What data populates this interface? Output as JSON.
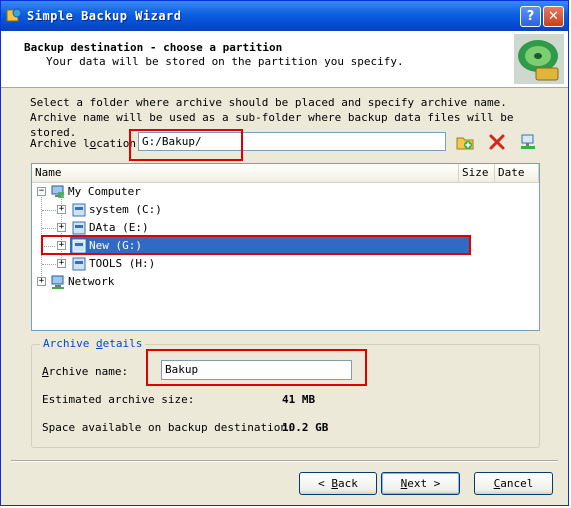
{
  "window": {
    "title": "Simple Backup Wizard",
    "help_label": "?",
    "close_label": "✕"
  },
  "header": {
    "title": "Backup destination - choose a partition",
    "subtitle": "Your data will be stored on the partition you specify."
  },
  "instructions": "Select a folder where archive should be placed and specify archive name. Archive name will be used as a sub-folder where backup data files will be stored.",
  "location": {
    "label_before": "Archive l",
    "label_hotkey": "o",
    "label_after": "cation:",
    "value": "G:/Bakup/"
  },
  "tree": {
    "columns": [
      "Name",
      "Size",
      "Date"
    ],
    "root": {
      "label": "My Computer",
      "expander": "−"
    },
    "drives": [
      {
        "label": "system (C:)",
        "expander": "+"
      },
      {
        "label": "DAta (E:)",
        "expander": "+"
      },
      {
        "label": "New (G:)",
        "expander": "+",
        "selected": true
      },
      {
        "label": "TOOLS (H:)",
        "expander": "+"
      }
    ],
    "network": {
      "label": "Network",
      "expander": "+"
    }
  },
  "details": {
    "group_label_before": "Archive ",
    "group_label_hotkey": "d",
    "group_label_after": "etails",
    "name_label_hotkey": "A",
    "name_label_after": "rchive name:",
    "name_value": "Bakup",
    "size_label": "Estimated archive size:",
    "size_value": "41 MB",
    "space_label": "Space available on backup destination:",
    "space_value": "10.2 GB"
  },
  "buttons": {
    "back_prefix": "< ",
    "back_hotkey": "B",
    "back_rest": "ack",
    "next_hotkey": "N",
    "next_rest": "ext >",
    "cancel_hotkey": "C",
    "cancel_rest": "ancel"
  },
  "colors": {
    "highlight": "#316ac5",
    "annotation": "#e00000",
    "titlebar": "#0a5fe0"
  }
}
